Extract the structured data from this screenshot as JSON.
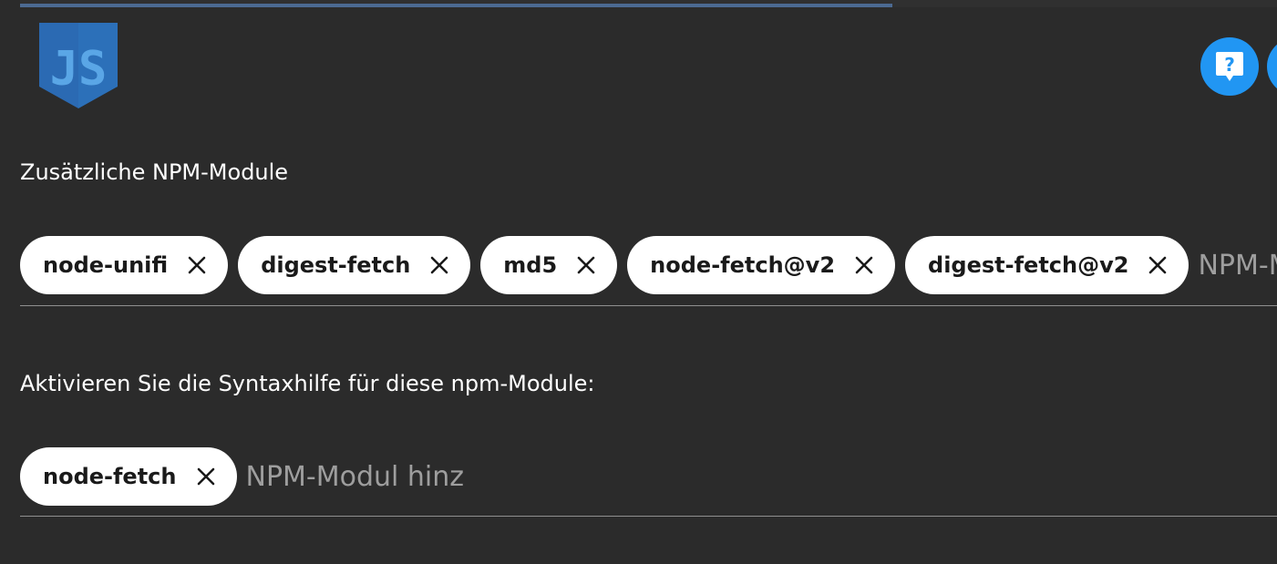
{
  "header": {
    "logo_icon": "javascript-logo-icon",
    "help_icon": "help-icon"
  },
  "npm_modules": {
    "label": "Zusätzliche NPM-Module",
    "chips": [
      "node-unifi",
      "digest-fetch",
      "md5",
      "node-fetch@v2",
      "digest-fetch@v2"
    ],
    "input_placeholder": "NPM-Modul hinzufügen"
  },
  "syntax_help": {
    "label": "Aktivieren Sie die Syntaxhilfe für diese npm-Module:",
    "chips": [
      "node-fetch"
    ],
    "input_placeholder": "NPM-Modul hinz"
  },
  "colors": {
    "background": "#2b2b2b",
    "accent": "#2196f3",
    "chip_bg": "#ffffff",
    "top_bar": "#4c6a92",
    "logo": "#2b6ab3"
  }
}
